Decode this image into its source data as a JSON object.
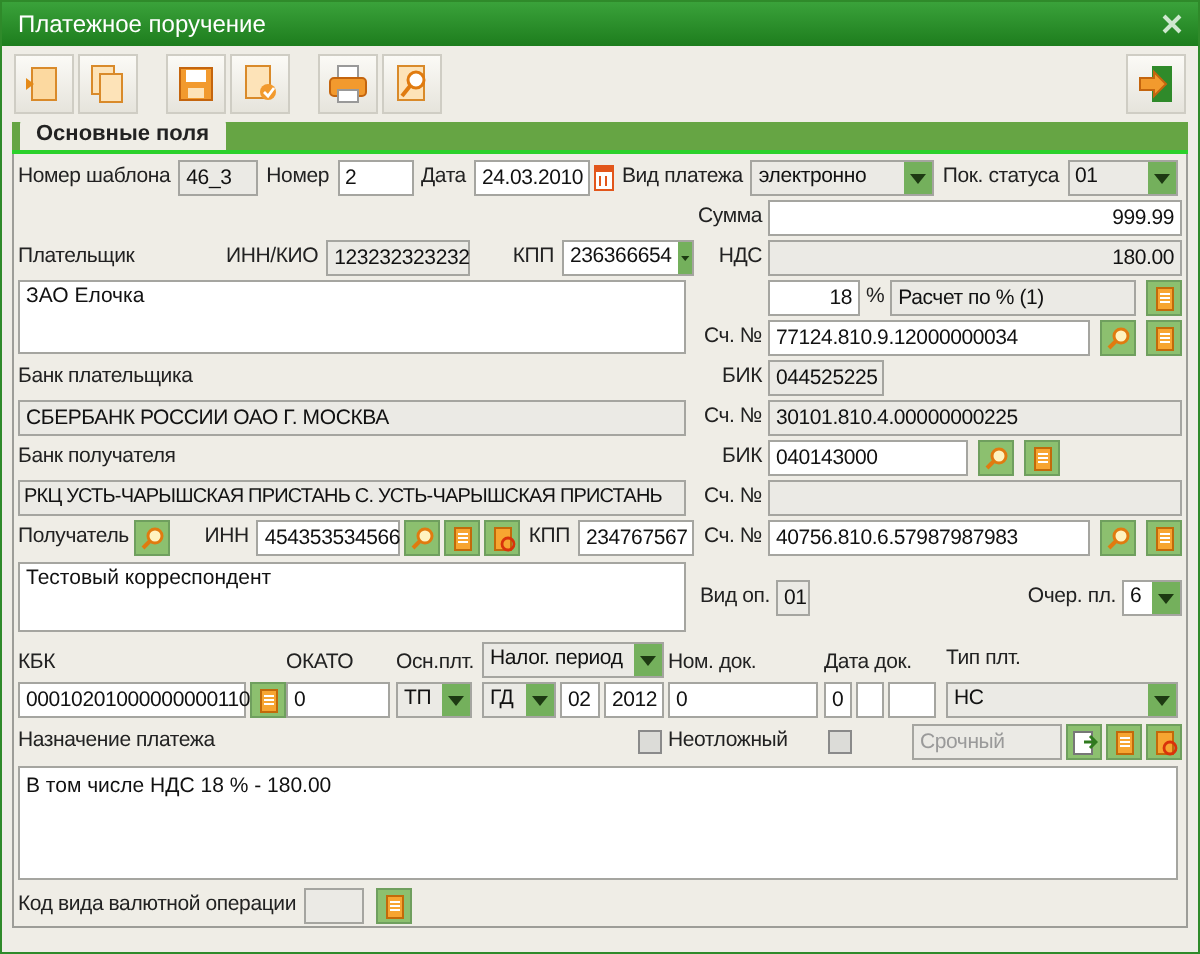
{
  "window": {
    "title": "Платежное поручение"
  },
  "tabs": [
    {
      "label": "Основные поля",
      "selected": true
    }
  ],
  "template_number": {
    "label": "Номер шаблона",
    "value": "46_3"
  },
  "number": {
    "label": "Номер",
    "value": "2"
  },
  "date": {
    "label": "Дата",
    "value": "24.03.2010"
  },
  "payment_type": {
    "label": "Вид платежа",
    "value": "электронно"
  },
  "status": {
    "label": "Пок. статуса",
    "value": "01"
  },
  "amount": {
    "label": "Сумма",
    "value": "999.99"
  },
  "payer": {
    "label": "Плательщик",
    "inn_label": "ИНН/КИО",
    "inn": "123232323232",
    "kpp_label": "КПП",
    "kpp": "236366654",
    "name": "ЗАО Елочка",
    "account_label": "Сч. №",
    "account": "77124.810.9.12000000034"
  },
  "vat": {
    "label": "НДС",
    "value": "180.00",
    "rate": "18",
    "percent": "%",
    "method": "Расчет по % (1)"
  },
  "payer_bank": {
    "label": "Банк плательщика",
    "bik_label": "БИК",
    "bik": "044525225",
    "name": "СБЕРБАНК РОССИИ ОАО Г. МОСКВА",
    "account_label": "Сч. №",
    "account": "30101.810.4.00000000225"
  },
  "payee_bank": {
    "label": "Банк получателя",
    "bik_label": "БИК",
    "bik": "040143000",
    "name": "РКЦ УСТЬ-ЧАРЫШСКАЯ ПРИСТАНЬ С. УСТЬ-ЧАРЫШСКАЯ ПРИСТАНЬ",
    "account_label": "Сч. №"
  },
  "payee": {
    "label": "Получатель",
    "inn_label": "ИНН",
    "inn": "454353534566",
    "kpp_label": "КПП",
    "kpp": "234767567",
    "account_label": "Сч. №",
    "account": "40756.810.6.57987987983",
    "name": "Тестовый корреспондент"
  },
  "operation_type": {
    "label": "Вид оп.",
    "value": "01"
  },
  "priority": {
    "label": "Очер. пл.",
    "value": "6"
  },
  "tax": {
    "kbk_label": "КБК",
    "kbk": "00010201000000000110",
    "okato_label": "ОКАТО",
    "okato": "0",
    "basis_label": "Осн.плт.",
    "period_kind": "Налог. период",
    "basis": "ТП",
    "period": "ГД",
    "period_month": "02",
    "period_year": "2012",
    "doc_number_label": "Ном. док.",
    "doc_number": "0",
    "doc_date_label": "Дата док.",
    "doc_date_day": "0",
    "payer_type_label": "Тип плт.",
    "payer_type": "НС"
  },
  "purpose": {
    "label": "Назначение платежа",
    "text": "В том числе НДС 18 % - 180.00"
  },
  "urgent": {
    "label": "Неотложный",
    "checked": false
  },
  "flag": {
    "checked": false
  },
  "speed": {
    "value": "Срочный",
    "disabled": true
  },
  "currency_operation": {
    "label": "Код вида валютной операции"
  }
}
